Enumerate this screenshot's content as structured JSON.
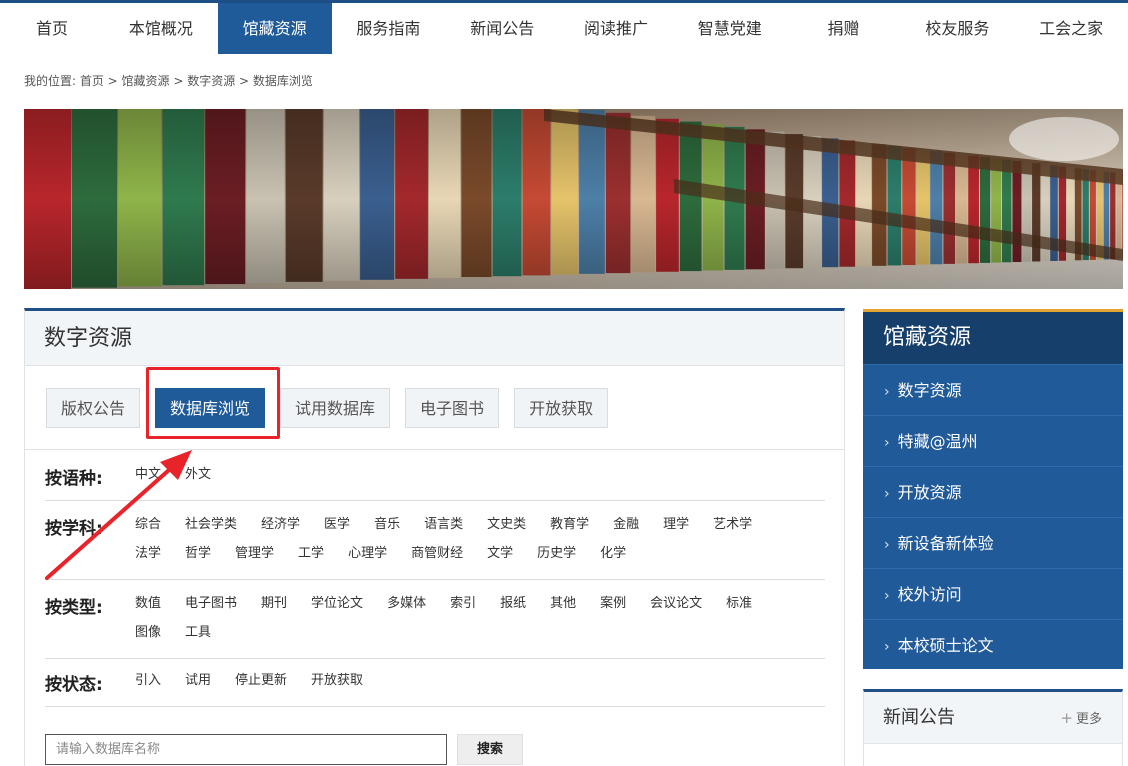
{
  "nav": [
    "首页",
    "本馆概况",
    "馆藏资源",
    "服务指南",
    "新闻公告",
    "阅读推广",
    "智慧党建",
    "捐赠",
    "校友服务",
    "工会之家"
  ],
  "breadcrumb": "我的位置: 首页 > 馆藏资源 > 数字资源 > 数据库浏览",
  "main": {
    "title": "数字资源",
    "tabs": [
      "版权公告",
      "数据库浏览",
      "试用数据库",
      "电子图书",
      "开放获取"
    ],
    "filters": {
      "language": {
        "label": "按语种:",
        "items": [
          "中文",
          "外文"
        ]
      },
      "subject": {
        "label": "按学科:",
        "items": [
          "综合",
          "社会学类",
          "经济学",
          "医学",
          "音乐",
          "语言类",
          "文史类",
          "教育学",
          "金融",
          "理学",
          "艺术学",
          "法学",
          "哲学",
          "管理学",
          "工学",
          "心理学",
          "商管财经",
          "文学",
          "历史学",
          "化学"
        ]
      },
      "type": {
        "label": "按类型:",
        "items": [
          "数值",
          "电子图书",
          "期刊",
          "学位论文",
          "多媒体",
          "索引",
          "报纸",
          "其他",
          "案例",
          "会议论文",
          "标准",
          "图像",
          "工具"
        ]
      },
      "status": {
        "label": "按状态:",
        "items": [
          "引入",
          "试用",
          "停止更新",
          "开放获取"
        ]
      }
    },
    "search": {
      "placeholder": "请输入数据库名称",
      "button": "搜索"
    }
  },
  "sidebar": {
    "title": "馆藏资源",
    "items": [
      "数字资源",
      "特藏@温州",
      "开放资源",
      "新设备新体验",
      "校外访问",
      "本校硕士论文"
    ]
  },
  "news": {
    "title": "新闻公告",
    "more": "更多"
  },
  "colors": {
    "nav_active": "#1f5a99",
    "sidebar": "#215a98",
    "sidebar_head": "#173f6b",
    "highlight": "#e8232a",
    "accent": "#e4a431"
  }
}
